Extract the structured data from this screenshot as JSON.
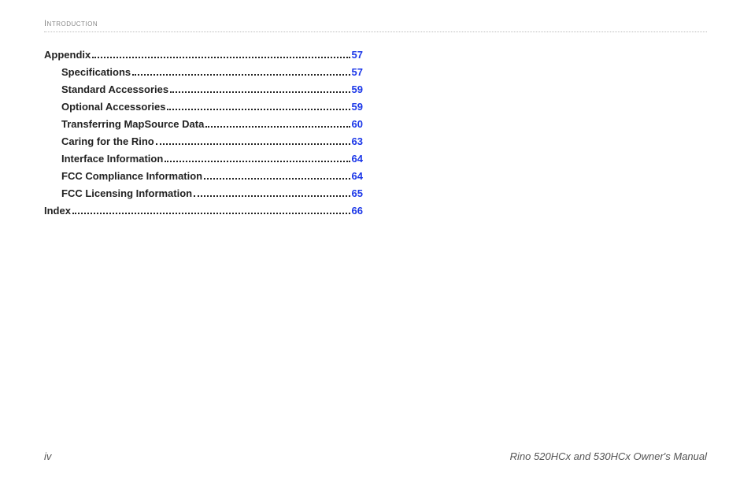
{
  "header": {
    "section_label": "Introduction"
  },
  "toc": {
    "entries": [
      {
        "label": "Appendix",
        "page": "57",
        "level": "top"
      },
      {
        "label": "Specifications",
        "page": "57",
        "level": "sub"
      },
      {
        "label": "Standard Accessories",
        "page": "59",
        "level": "sub"
      },
      {
        "label": "Optional Accessories",
        "page": "59",
        "level": "sub"
      },
      {
        "label": "Transferring MapSource Data",
        "page": "60",
        "level": "sub"
      },
      {
        "label": "Caring for the Rino",
        "page": "63",
        "level": "sub"
      },
      {
        "label": "Interface Information",
        "page": "64",
        "level": "sub"
      },
      {
        "label": "FCC Compliance Information",
        "page": "64",
        "level": "sub"
      },
      {
        "label": "FCC Licensing Information",
        "page": "65",
        "level": "sub"
      },
      {
        "label": "Index",
        "page": "66",
        "level": "top"
      }
    ]
  },
  "footer": {
    "page_number": "iv",
    "manual_title": "Rino 520HCx and 530HCx Owner's Manual"
  }
}
